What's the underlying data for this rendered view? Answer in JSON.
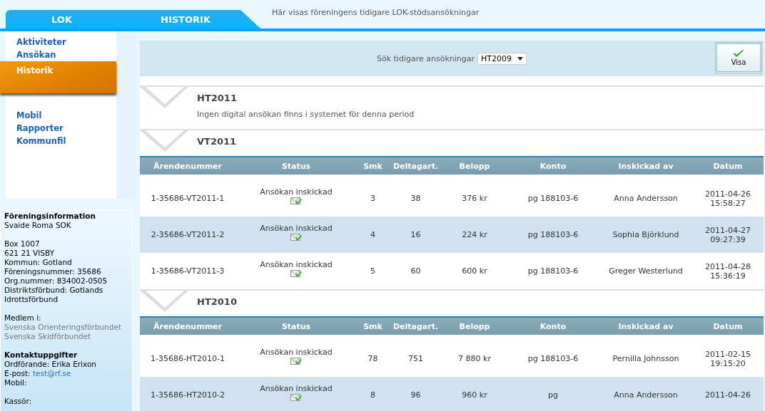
{
  "header": {
    "tabs": [
      {
        "label": "LOK",
        "selected": false
      },
      {
        "label": "HISTORIK",
        "selected": true
      }
    ],
    "description": "Här visas föreningens tidigare LOK-stödsansökningar"
  },
  "sidebar": {
    "nav": [
      {
        "label": "Aktiviteter",
        "selected": false
      },
      {
        "label": "Ansökan",
        "selected": false
      },
      {
        "label": "Historik",
        "selected": true
      },
      {
        "label": "Mobil",
        "selected": false
      },
      {
        "label": "Rapporter",
        "selected": false
      },
      {
        "label": "Kommunfil",
        "selected": false
      }
    ],
    "info": [
      {
        "title": "Föreningsinformation",
        "lines": [
          {
            "kind": "text",
            "text": "Svaide Roma SOK"
          }
        ]
      },
      {
        "lines": [
          {
            "kind": "text",
            "text": "Box 1007"
          },
          {
            "kind": "text",
            "text": "621 21 VISBY"
          },
          {
            "kind": "text",
            "text": "Kommun: Gotland"
          },
          {
            "kind": "text",
            "text": "Föreningsnummer: 35686"
          },
          {
            "kind": "text",
            "text": "Org.nummer: 834002-0505"
          },
          {
            "kind": "text",
            "text": "Distriktsförbund: Gotlands Idrottsförbund"
          }
        ]
      },
      {
        "lines": [
          {
            "kind": "text",
            "text": "Medlem i:"
          },
          {
            "kind": "muted",
            "text": "Svenska Orienteringsförbundet"
          },
          {
            "kind": "muted",
            "text": "Svenska Skidförbundet"
          }
        ]
      },
      {
        "title": "Kontaktuppgifter",
        "lines": [
          {
            "kind": "text",
            "text": "Ordförande: Erika Erixon"
          },
          {
            "kind": "email",
            "text": "E-post:",
            "link": "test@rf.se"
          },
          {
            "kind": "text",
            "text": "Mobil:"
          }
        ]
      },
      {
        "lines": [
          {
            "kind": "text",
            "text": "Kassör:"
          }
        ]
      }
    ]
  },
  "search": {
    "label": "Sök tidigare ansökningar",
    "select": {
      "value": "HT2009"
    },
    "button": "Visa"
  },
  "periods": [
    {
      "title": "HT2011",
      "message": "Ingen digital ansökan finns i systemet för denna period"
    },
    {
      "title": "VT2011",
      "columns": [
        "Ärendenummer",
        "Status",
        "Smk",
        "Deltagart.",
        "Belopp",
        "Konto",
        "Inskickad av",
        "Datum"
      ],
      "rows": [
        {
          "cells": [
            "1-35686-VT2011-1",
            "Ansökan inskickad",
            "3",
            "38",
            "376 kr",
            "pg 188103-6",
            "Anna Andersson",
            "2011-04-26 15:58:27"
          ]
        },
        {
          "cells": [
            "2-35686-VT2011-2",
            "Ansökan inskickad",
            "4",
            "16",
            "224 kr",
            "pg 188103-6",
            "Sophia Björklund",
            "2011-04-27 09:27:39"
          ]
        },
        {
          "cells": [
            "1-35686-VT2011-3",
            "Ansökan inskickad",
            "5",
            "60",
            "600 kr",
            "pg 188103-6",
            "Greger Westerlund",
            "2011-04-28 15:36:19"
          ]
        }
      ]
    },
    {
      "title": "HT2010",
      "columns": [
        "Ärendenummer",
        "Status",
        "Smk",
        "Deltagart.",
        "Belopp",
        "Konto",
        "Inskickad av",
        "Datum"
      ],
      "rows": [
        {
          "cells": [
            "1-35686-HT2010-1",
            "Ansökan inskickad",
            "78",
            "751",
            "7 880 kr",
            "pg 188103-6",
            "Pernilla Johnsson",
            "2011-02-15 19:15:20"
          ]
        },
        {
          "cells": [
            "1-35686-HT2010-2",
            "Ansökan inskickad",
            "8",
            "96",
            "960 kr",
            "pg",
            "Anna Andersson",
            "2011-04-26"
          ]
        }
      ]
    }
  ]
}
